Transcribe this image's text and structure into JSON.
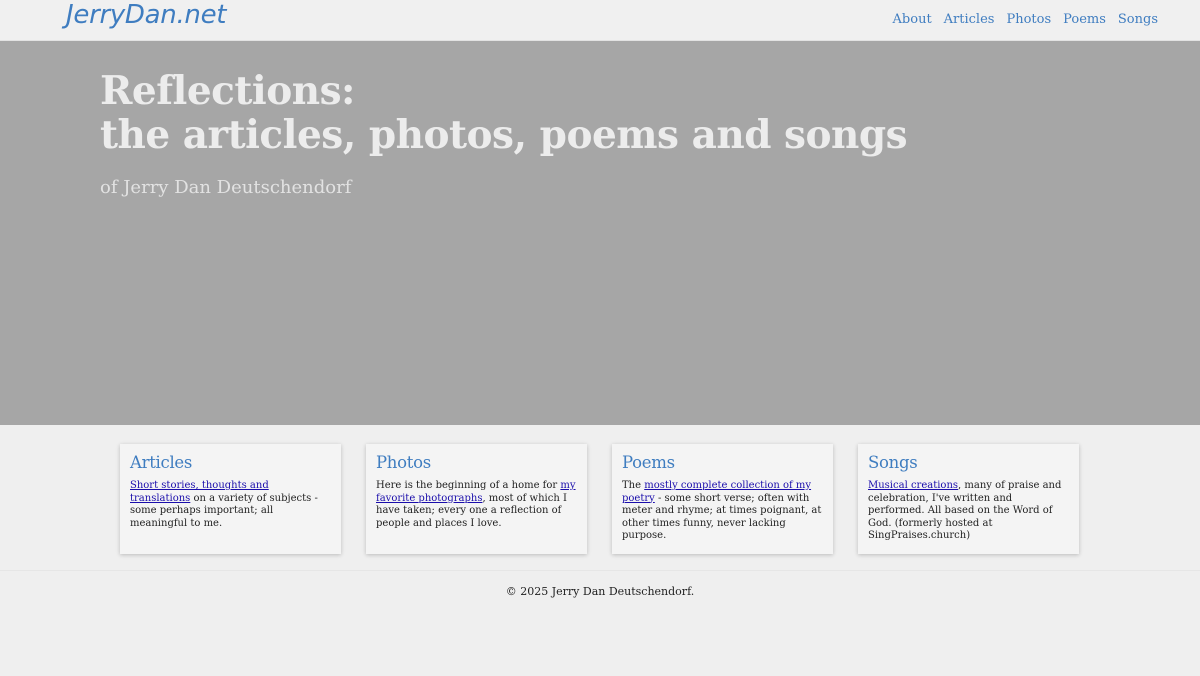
{
  "brand": {
    "name": "JerryDan.net"
  },
  "nav": {
    "items": [
      {
        "label": "About"
      },
      {
        "label": "Articles"
      },
      {
        "label": "Photos"
      },
      {
        "label": "Poems"
      },
      {
        "label": "Songs"
      }
    ]
  },
  "hero": {
    "title_line1": "Reflections:",
    "title_line2": "the articles, photos, poems and songs",
    "subtitle": "of Jerry Dan Deutschendorf"
  },
  "cards": [
    {
      "title": "Articles",
      "link_text": "Short stories, thoughts and translations",
      "before": "",
      "after": " on a variety of subjects - some perhaps important; all meaningful to me."
    },
    {
      "title": "Photos",
      "link_text": "my favorite photographs",
      "before": "Here is the beginning of a home for ",
      "after": ", most of which I have taken; every one a reflection of people and places I love."
    },
    {
      "title": "Poems",
      "link_text": "mostly complete collection of my poetry",
      "before": "The ",
      "after": " - some short verse; often with meter and rhyme; at times poignant, at other times funny, never lacking purpose."
    },
    {
      "title": "Songs",
      "link_text": "Musical creations",
      "before": "",
      "after": ", many of praise and celebration, I've written and performed. All based on the Word of God. (formerly hosted at SingPraises.church)"
    }
  ],
  "footer": {
    "text": "© 2025 Jerry Dan Deutschendorf."
  },
  "colors": {
    "accent": "#3f7dc0",
    "hero_bg": "#a6a6a6",
    "link": "#1a0dab"
  }
}
